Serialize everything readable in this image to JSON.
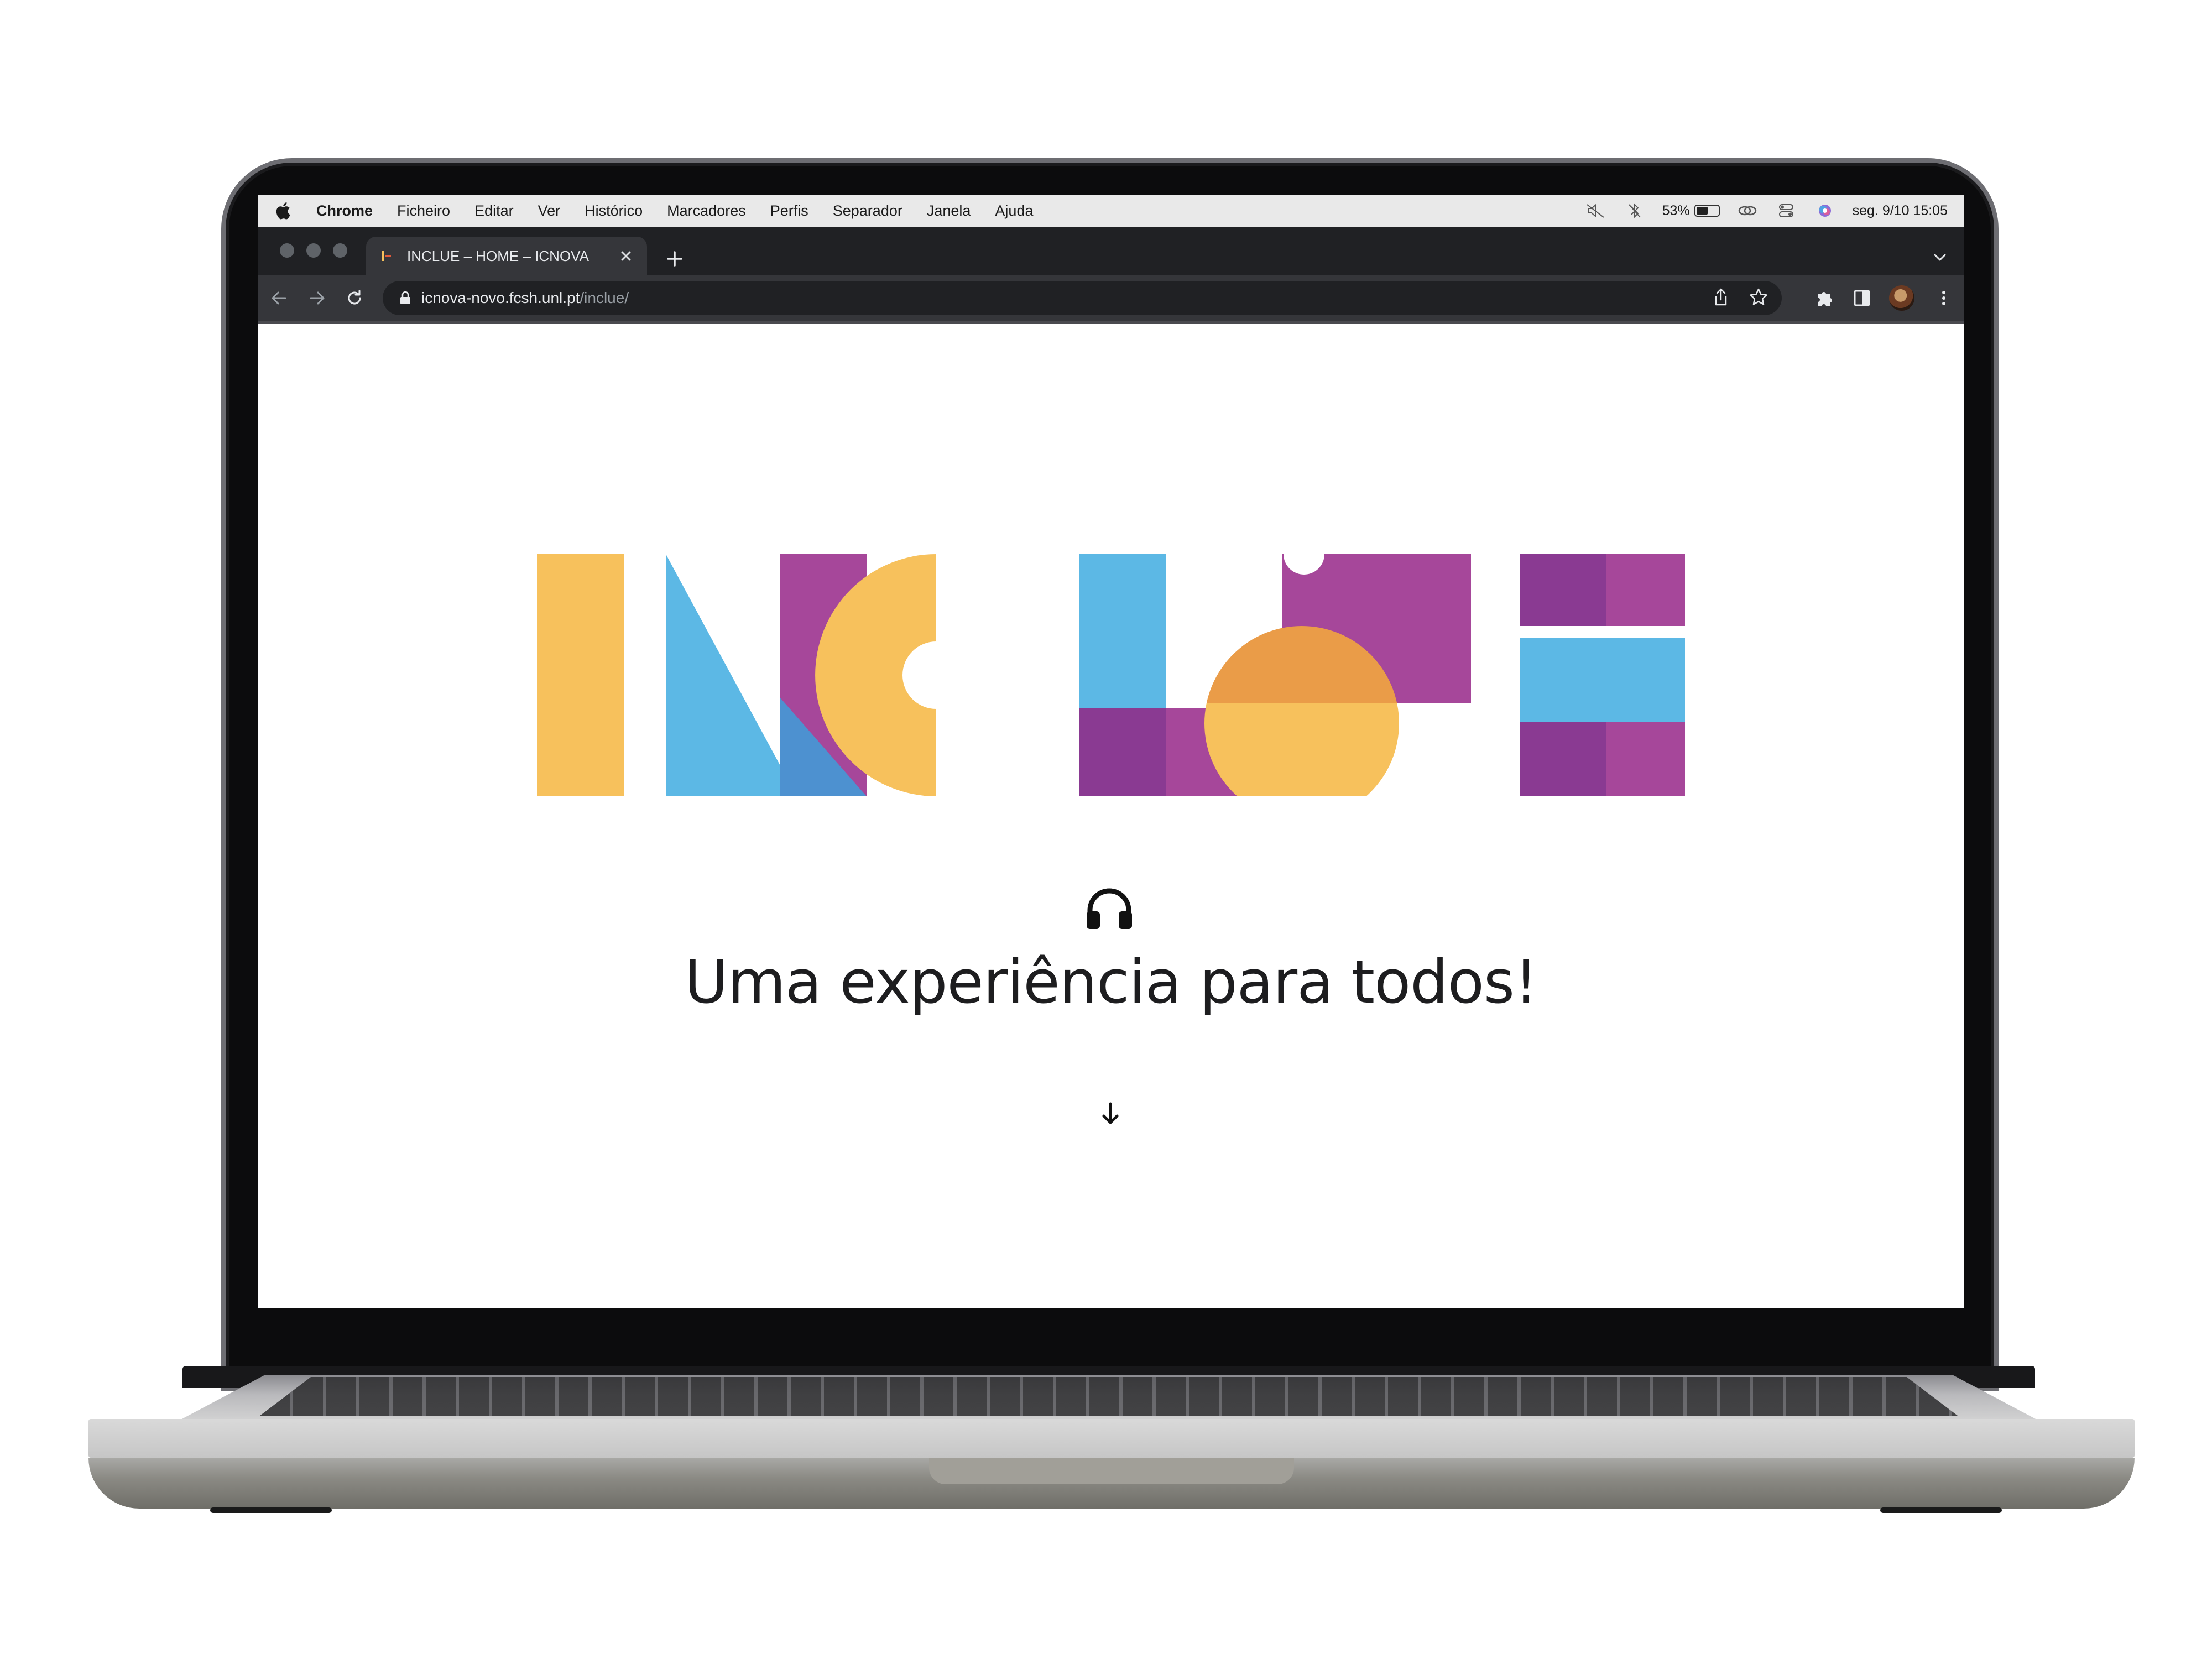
{
  "menubar": {
    "app": "Chrome",
    "items": [
      "Ficheiro",
      "Editar",
      "Ver",
      "Histórico",
      "Marcadores",
      "Perfis",
      "Separador",
      "Janela",
      "Ajuda"
    ],
    "battery_percent": "53%",
    "battery_level": 0.53,
    "clock": "seg. 9/10  15:05",
    "status_icons": [
      "mute-icon",
      "bluetooth-icon",
      "battery-icon",
      "link-icon",
      "control-center-icon",
      "siri-icon"
    ]
  },
  "browser": {
    "tab_title": "INCLUE – HOME – ICNOVA",
    "url_host": "icnova-novo.fcsh.unl.pt",
    "url_path": "/inclue/"
  },
  "page": {
    "logo_alt": "INCLUE",
    "tagline": "Uma experiência para todos!"
  },
  "colors": {
    "yellow": "#f7c15c",
    "blue": "#5cb8e5",
    "purple": "#a6479a",
    "dark_purple": "#8a3a92",
    "orange": "#ea9c48",
    "mid_blue": "#4d91d0"
  }
}
